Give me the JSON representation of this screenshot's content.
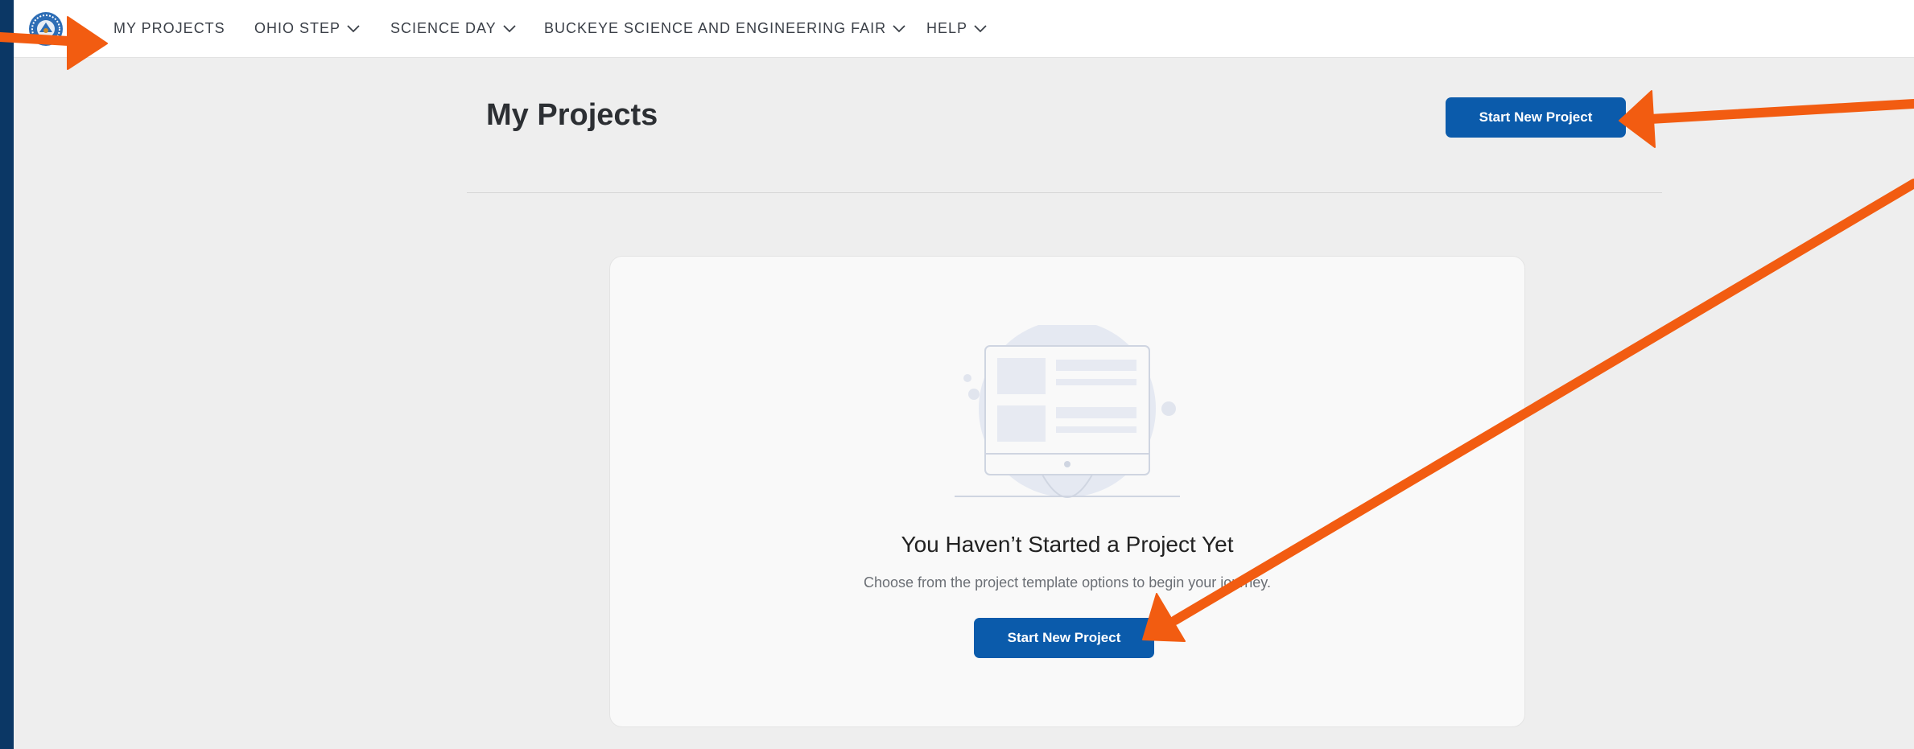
{
  "nav": {
    "items": [
      {
        "label": "MY PROJECTS",
        "has_dropdown": false
      },
      {
        "label": "OHIO STEP",
        "has_dropdown": true
      },
      {
        "label": "SCIENCE DAY",
        "has_dropdown": true
      },
      {
        "label": "BUCKEYE SCIENCE AND ENGINEERING FAIR",
        "has_dropdown": true
      },
      {
        "label": "HELP",
        "has_dropdown": true
      }
    ]
  },
  "header": {
    "title": "My Projects",
    "start_button_label": "Start New Project"
  },
  "empty_state": {
    "title": "You Haven’t Started a Project Yet",
    "subtitle": "Choose from the project template options to begin your journey.",
    "button_label": "Start New Project"
  },
  "colors": {
    "outer_frame": "#0b3765",
    "primary_button": "#0b5bab",
    "annotation_arrow": "#f25c11",
    "page_background": "#eeeeee"
  },
  "icons": {
    "logo": "organization-seal-logo",
    "dropdown": "chevron-down-icon",
    "illustration": "empty-projects-monitor-illustration"
  }
}
